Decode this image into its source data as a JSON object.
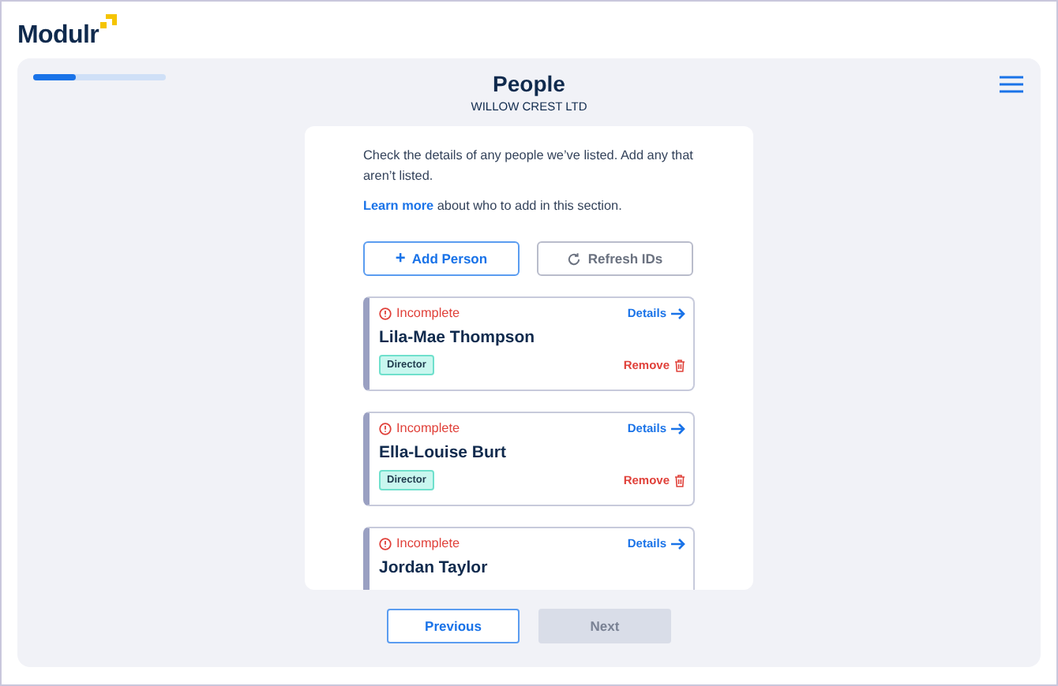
{
  "brand": {
    "name": "Modulr"
  },
  "progress": {
    "level": 0.32
  },
  "header": {
    "title": "People",
    "subtitle": "WILLOW CREST LTD"
  },
  "intro": {
    "text": "Check the details of any people we’ve listed. Add any that aren’t listed.",
    "link": "Learn more",
    "link_suffix": "about who to add in this section."
  },
  "actions": [
    {
      "kind": "add",
      "label": "Add Person",
      "icon": "+"
    },
    {
      "kind": "refresh",
      "label": "Refresh IDs"
    }
  ],
  "people": [
    {
      "status": "Incomplete",
      "name": "Lila-Mae Thompson",
      "role": "Director",
      "details": "Details",
      "remove": "Remove"
    },
    {
      "status": "Incomplete",
      "name": "Ella-Louise Burt",
      "role": "Director",
      "details": "Details",
      "remove": "Remove"
    },
    {
      "status": "Incomplete",
      "name": "Jordan Taylor",
      "details": "Details"
    }
  ],
  "nav": [
    {
      "label": "Previous",
      "disabled": false
    },
    {
      "label": "Next",
      "disabled": true
    }
  ]
}
